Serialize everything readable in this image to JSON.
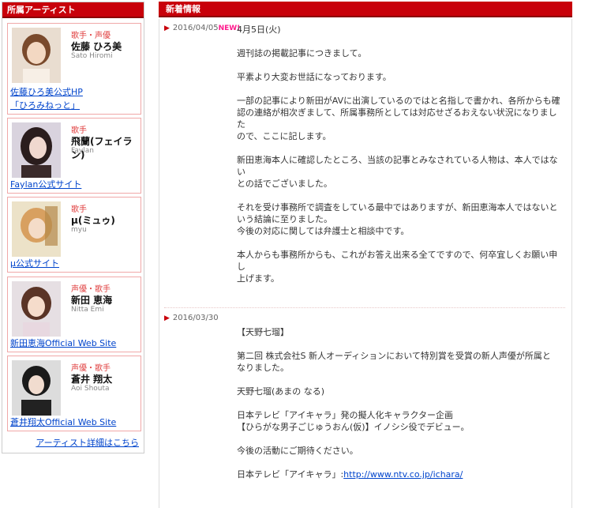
{
  "sidebar": {
    "title": "所属アーティスト",
    "artists": [
      {
        "role": "歌手・声優",
        "name": "佐藤 ひろ美",
        "name_en": "Sato Hiromi",
        "links": [
          "佐藤ひろ美公式HP",
          "「ひろみねっと」"
        ]
      },
      {
        "role": "歌手",
        "name": "飛蘭(フェイラン)",
        "name_en": "Faylan",
        "links": [
          "Faylan公式サイト"
        ]
      },
      {
        "role": "歌手",
        "name": "μ(ミュゥ)",
        "name_en": "myu",
        "links": [
          "μ公式サイト"
        ]
      },
      {
        "role": "声優・歌手",
        "name": "新田 恵海",
        "name_en": "Nitta Emi",
        "links": [
          "新田恵海Official Web Site"
        ]
      },
      {
        "role": "声優・歌手",
        "name": "蒼井 翔太",
        "name_en": "Aoi Shouta",
        "links": [
          "蒼井翔太Official Web Site"
        ]
      }
    ],
    "more_link": "アーティスト詳細はこちら"
  },
  "news": {
    "title": "新着情報",
    "items": [
      {
        "date": "2016/04/05",
        "new_badge": "NEW!",
        "paragraphs": [
          [
            "4月5日(火)"
          ],
          [
            "週刊誌の掲載記事につきまして。"
          ],
          [
            "平素より大変お世話になっております。"
          ],
          [
            "一部の記事により新田がAVに出演しているのではと名指しで書かれ、各所からも確",
            "認の連絡が相次ぎまして、所属事務所としては対応せざるおえない状況になりました",
            "ので、ここに記します。"
          ],
          [
            "新田恵海本人に確認したところ、当該の記事とみなされている人物は、本人ではない",
            "との話でございました。"
          ],
          [
            "それを受け事務所で調査をしている最中ではありますが、新田恵海本人ではないと",
            "いう結論に至りました。",
            "今後の対応に関しては弁護士と相談中です。"
          ],
          [
            "本人からも事務所からも、これがお答え出来る全てですので、何卒宜しくお願い申し",
            "上げます。"
          ]
        ]
      },
      {
        "date": "2016/03/30",
        "paragraphs": [
          [
            "【天野七瑠】"
          ],
          [
            "第二回 株式会社S 新人オーディションにおいて特別賞を受賞の新人声優が所属と",
            "なりました。"
          ],
          [
            "天野七瑠(あまの なる)"
          ],
          [
            "日本テレビ「アイキャラ」発の擬人化キャラクター企画",
            "【ひらがな男子ごじゅうおん(仮)】イノシシ役でデビュー。"
          ],
          [
            "今後の活動にご期待ください。"
          ]
        ],
        "link_prefix": "日本テレビ「アイキャラ」:",
        "link_text": "http://www.ntv.co.jp/ichara/"
      }
    ]
  },
  "colors": {
    "accent": "#c8000a",
    "new_badge": "#ff1a8c",
    "link": "#0044cc",
    "card_border": "#f0a8a8"
  },
  "icons": [
    "artist-photo-icon",
    "triangle-bullet-icon"
  ]
}
